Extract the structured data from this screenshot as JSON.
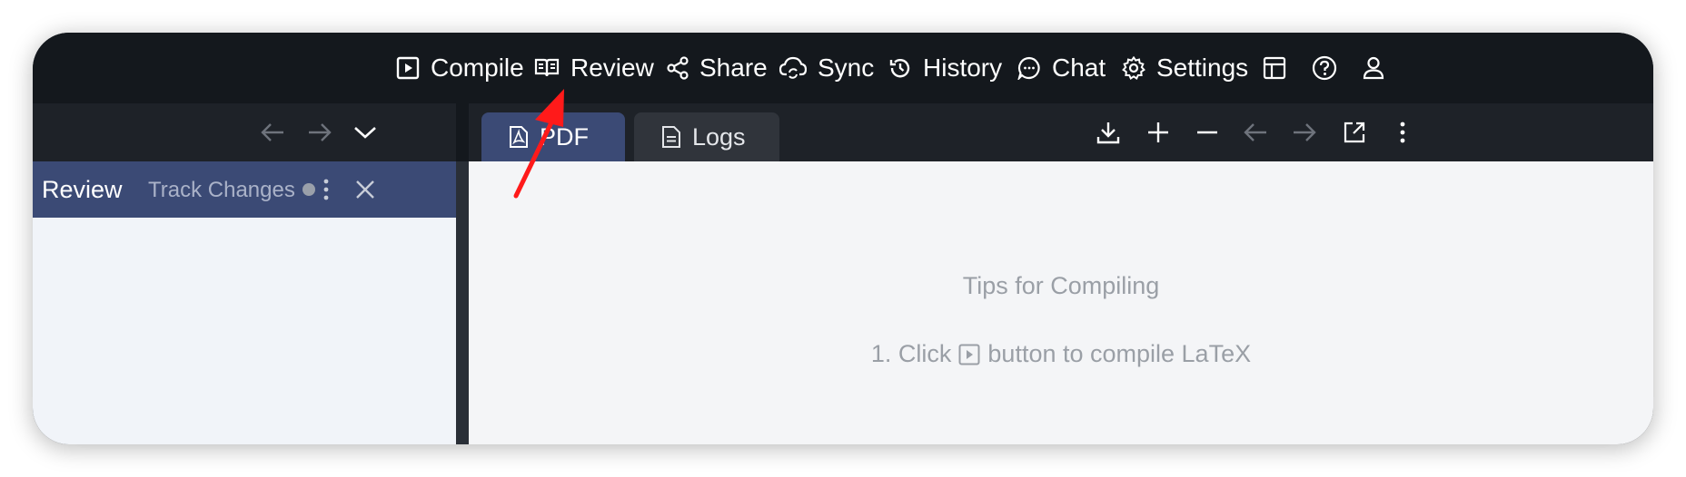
{
  "topbar": {
    "items": [
      {
        "label": "Compile",
        "icon": "play-icon"
      },
      {
        "label": "Review",
        "icon": "book-icon"
      },
      {
        "label": "Share",
        "icon": "share-icon"
      },
      {
        "label": "Sync",
        "icon": "cloud-sync-icon"
      },
      {
        "label": "History",
        "icon": "history-icon"
      },
      {
        "label": "Chat",
        "icon": "chat-icon"
      },
      {
        "label": "Settings",
        "icon": "gear-icon"
      }
    ],
    "right_icons": [
      "layout-icon",
      "help-icon",
      "user-icon"
    ]
  },
  "left_panel": {
    "toolbar_icons": [
      "arrow-left-icon",
      "arrow-right-icon",
      "chevron-down-icon"
    ],
    "review_title": "Review",
    "track_changes_label": "Track Changes",
    "header_icons": [
      "more-vertical-icon",
      "close-icon"
    ]
  },
  "pdf_panel": {
    "tabs": [
      {
        "label": "PDF",
        "icon": "pdf-file-icon",
        "active": true
      },
      {
        "label": "Logs",
        "icon": "document-icon",
        "active": false
      }
    ],
    "toolbar_icons": [
      "download-icon",
      "zoom-in-icon",
      "zoom-out-icon",
      "arrow-left-icon",
      "arrow-right-icon",
      "open-external-icon",
      "more-vertical-icon"
    ],
    "tips_title": "Tips for Compiling",
    "tips_line_prefix": "1. Click",
    "tips_line_suffix": "button to compile LaTeX"
  },
  "colors": {
    "topbar_bg": "#14181d",
    "accent_tab": "#3b4a75",
    "annotation_arrow": "#ff1a1a"
  }
}
